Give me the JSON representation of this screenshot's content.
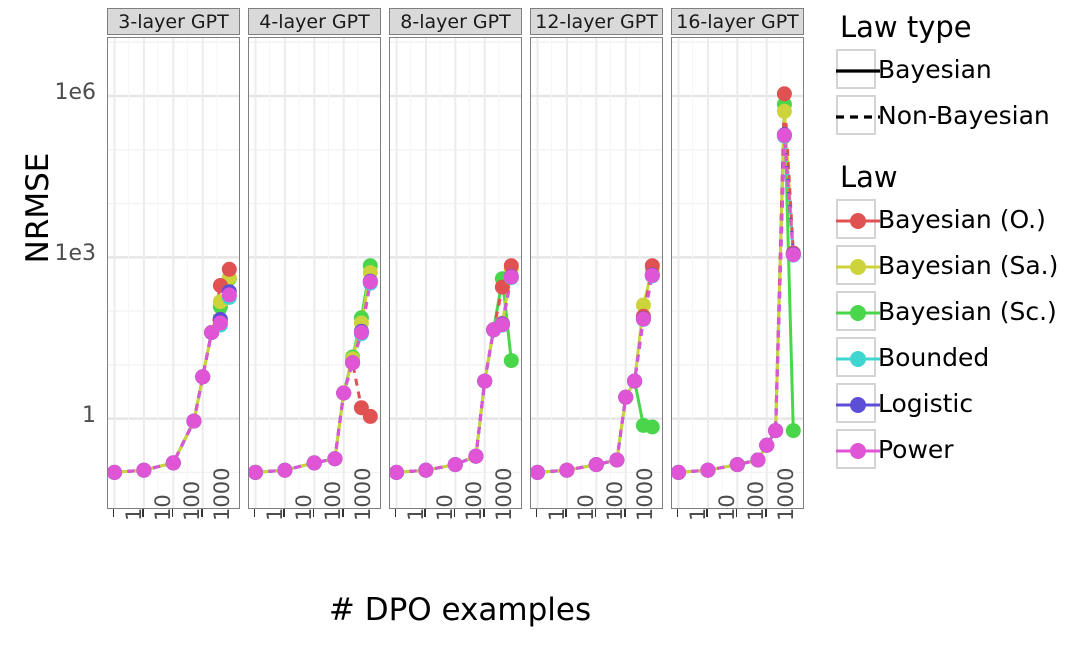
{
  "chart_data": {
    "type": "line",
    "title": "",
    "xlabel": "# DPO examples",
    "ylabel": "NRMSE",
    "x_scale": "log10",
    "y_scale": "log10",
    "grid": true,
    "legend_position": "right",
    "y_tick_labels": [
      "1e6",
      "1e3",
      "1"
    ],
    "y_tick_values": [
      1000000,
      1000,
      1
    ],
    "x_tick_labels": [
      "1",
      "10",
      "100",
      "1000"
    ],
    "x_tick_values": [
      1,
      10,
      100,
      1000
    ],
    "ylim": [
      0.02,
      12000000
    ],
    "xlim": [
      0.6,
      20000
    ],
    "facet_variable": "model",
    "facets": [
      "3-layer GPT",
      "4-layer GPT",
      "8-layer GPT",
      "12-layer GPT",
      "16-layer GPT"
    ],
    "x": [
      1,
      10,
      100,
      500,
      1000,
      2000,
      4000,
      8000
    ],
    "series_colors": {
      "Bayesian (O.)": "#e05252",
      "Bayesian (Sa.)": "#ccd33b",
      "Bayesian (Sc.)": "#4ad64a",
      "Bounded": "#40d6d0",
      "Logistic": "#5c4fd6",
      "Power": "#e055d6"
    },
    "series_linetypes": {
      "Bayesian (O.)": "dashed",
      "Bayesian (Sa.)": "solid",
      "Bayesian (Sc.)": "solid",
      "Bounded": "dashed",
      "Logistic": "dashed",
      "Power": "dashed"
    },
    "panels": [
      {
        "facet": "3-layer GPT",
        "series": [
          {
            "name": "Bayesian (O.)",
            "values": [
              0.1,
              0.11,
              0.15,
              0.9,
              6,
              40,
              300,
              600
            ]
          },
          {
            "name": "Bayesian (Sa.)",
            "values": [
              0.1,
              0.11,
              0.15,
              0.9,
              6,
              40,
              150,
              420
            ]
          },
          {
            "name": "Bayesian (Sc.)",
            "values": [
              0.1,
              0.11,
              0.15,
              0.9,
              6,
              40,
              120,
              400
            ]
          },
          {
            "name": "Bounded",
            "values": [
              0.1,
              0.11,
              0.15,
              0.9,
              6,
              40,
              55,
              180
            ]
          },
          {
            "name": "Logistic",
            "values": [
              0.1,
              0.11,
              0.15,
              0.9,
              6,
              40,
              70,
              230
            ]
          },
          {
            "name": "Power",
            "values": [
              0.1,
              0.11,
              0.15,
              0.9,
              6,
              40,
              60,
              200
            ]
          }
        ]
      },
      {
        "facet": "4-layer GPT",
        "series": [
          {
            "name": "Bayesian (O.)",
            "values": [
              0.1,
              0.11,
              0.15,
              0.18,
              3,
              11,
              1.6,
              1.1
            ]
          },
          {
            "name": "Bayesian (Sa.)",
            "values": [
              0.1,
              0.11,
              0.15,
              0.18,
              3,
              13,
              60,
              520
            ]
          },
          {
            "name": "Bayesian (Sc.)",
            "values": [
              0.1,
              0.11,
              0.15,
              0.18,
              3,
              14,
              75,
              700
            ]
          },
          {
            "name": "Bounded",
            "values": [
              0.1,
              0.11,
              0.15,
              0.18,
              3,
              11,
              38,
              330
            ]
          },
          {
            "name": "Logistic",
            "values": [
              0.1,
              0.11,
              0.15,
              0.18,
              3,
              11,
              42,
              360
            ]
          },
          {
            "name": "Power",
            "values": [
              0.1,
              0.11,
              0.15,
              0.18,
              3,
              11,
              40,
              350
            ]
          }
        ]
      },
      {
        "facet": "8-layer GPT",
        "series": [
          {
            "name": "Bayesian (O.)",
            "values": [
              0.1,
              0.11,
              0.14,
              0.2,
              5,
              45,
              280,
              700
            ]
          },
          {
            "name": "Bayesian (Sa.)",
            "values": [
              0.1,
              0.11,
              0.14,
              0.2,
              5,
              45,
              60,
              620
            ]
          },
          {
            "name": "Bayesian (Sc.)",
            "values": [
              0.1,
              0.11,
              0.14,
              0.2,
              5,
              45,
              400,
              12
            ]
          },
          {
            "name": "Bounded",
            "values": [
              0.1,
              0.11,
              0.14,
              0.2,
              5,
              45,
              55,
              420
            ]
          },
          {
            "name": "Logistic",
            "values": [
              0.1,
              0.11,
              0.14,
              0.2,
              5,
              45,
              58,
              440
            ]
          },
          {
            "name": "Power",
            "values": [
              0.1,
              0.11,
              0.14,
              0.2,
              5,
              45,
              56,
              430
            ]
          }
        ]
      },
      {
        "facet": "12-layer GPT",
        "series": [
          {
            "name": "Bayesian (O.)",
            "values": [
              0.1,
              0.11,
              0.14,
              0.17,
              2.5,
              5,
              80,
              700
            ]
          },
          {
            "name": "Bayesian (Sa.)",
            "values": [
              0.1,
              0.11,
              0.14,
              0.17,
              2.5,
              5,
              130,
              600
            ]
          },
          {
            "name": "Bayesian (Sc.)",
            "values": [
              0.1,
              0.11,
              0.14,
              0.17,
              2.5,
              5,
              0.75,
              0.7
            ]
          },
          {
            "name": "Bounded",
            "values": [
              0.1,
              0.11,
              0.14,
              0.17,
              2.5,
              5,
              70,
              450
            ]
          },
          {
            "name": "Logistic",
            "values": [
              0.1,
              0.11,
              0.14,
              0.17,
              2.5,
              5,
              72,
              470
            ]
          },
          {
            "name": "Power",
            "values": [
              0.1,
              0.11,
              0.14,
              0.17,
              2.5,
              5,
              71,
              460
            ]
          }
        ]
      },
      {
        "facet": "16-layer GPT",
        "series": [
          {
            "name": "Bayesian (O.)",
            "values": [
              0.1,
              0.11,
              0.14,
              0.17,
              0.32,
              0.6,
              1100000,
              1200
            ]
          },
          {
            "name": "Bayesian (Sa.)",
            "values": [
              0.1,
              0.11,
              0.14,
              0.17,
              0.32,
              0.6,
              520000,
              1200
            ]
          },
          {
            "name": "Bayesian (Sc.)",
            "values": [
              0.1,
              0.11,
              0.14,
              0.17,
              0.32,
              0.6,
              700000,
              0.6
            ]
          },
          {
            "name": "Bounded",
            "values": [
              0.1,
              0.11,
              0.14,
              0.17,
              0.32,
              0.6,
              180000,
              1100
            ]
          },
          {
            "name": "Logistic",
            "values": [
              0.1,
              0.11,
              0.14,
              0.17,
              0.32,
              0.6,
              190000,
              1150
            ]
          },
          {
            "name": "Power",
            "values": [
              0.1,
              0.11,
              0.14,
              0.17,
              0.32,
              0.6,
              185000,
              1120
            ]
          }
        ]
      }
    ]
  },
  "legend": {
    "linetype_title": "Law type",
    "linetype_items": [
      {
        "label": "Bayesian",
        "style": "solid"
      },
      {
        "label": "Non-Bayesian",
        "style": "dashed"
      }
    ],
    "color_title": "Law",
    "color_items": [
      {
        "label": "Bayesian (O.)",
        "color": "#e05252"
      },
      {
        "label": "Bayesian (Sa.)",
        "color": "#ccd33b"
      },
      {
        "label": "Bayesian (Sc.)",
        "color": "#4ad64a"
      },
      {
        "label": "Bounded",
        "color": "#40d6d0"
      },
      {
        "label": "Logistic",
        "color": "#5c4fd6"
      },
      {
        "label": "Power",
        "color": "#e055d6"
      }
    ]
  }
}
